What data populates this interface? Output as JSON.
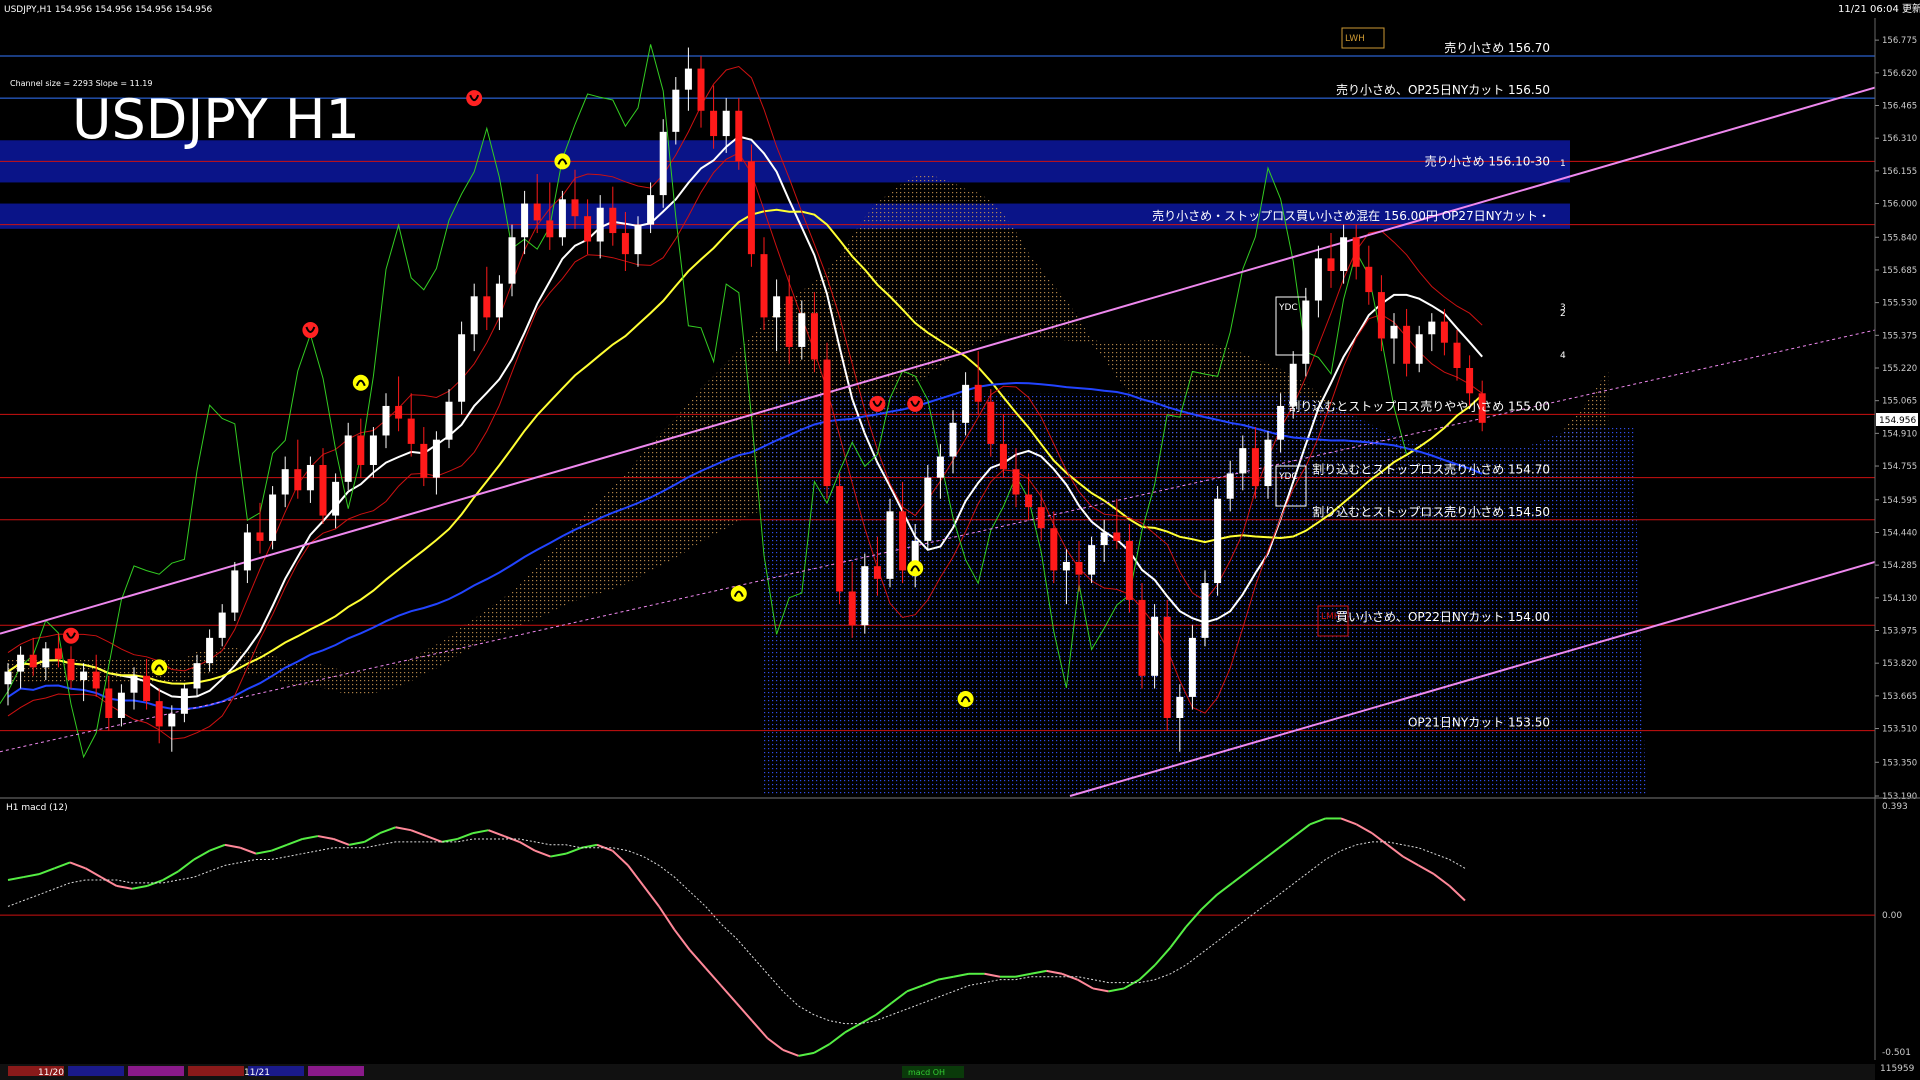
{
  "header": {
    "symbol_info": "USDJPY,H1  154.956 154.956 154.956 154.956",
    "timestamp": "11/21 06:04 更新",
    "channel_info": "Channel size = 2293 Slope = 11.19",
    "big_title": "USDJPY H1"
  },
  "macd_panel": {
    "title": "H1  macd (12)",
    "scale_top": "0.393",
    "scale_zero": "0.00",
    "scale_bottom": "-0.501"
  },
  "time_axis": {
    "labels": [
      "11/20",
      "11/21"
    ]
  },
  "current_price": "154.956",
  "volume_label": "115959",
  "bottom_tab": "macd OH",
  "colors": {
    "background": "#000000",
    "bull_candle": "#ffffff",
    "bear_candle": "#ff1a1a",
    "band": "#0a1488",
    "channel": "#ee88ee",
    "ma_white": "#ffffff",
    "ma_yellow": "#ffff33",
    "ma_blue": "#2244ff",
    "macd_up": "#55ee44",
    "macd_down": "#ff8899"
  },
  "chart_data": [
    {
      "type": "candlestick",
      "name": "USDJPY H1",
      "y_ticks": [
        "156.775",
        "156.620",
        "156.465",
        "156.310",
        "156.155",
        "156.000",
        "155.840",
        "155.685",
        "155.530",
        "155.375",
        "155.220",
        "155.065",
        "154.910",
        "154.755",
        "154.595",
        "154.440",
        "154.285",
        "154.130",
        "153.975",
        "153.820",
        "153.665",
        "153.510",
        "153.350",
        "153.190"
      ],
      "ylim": [
        153.19,
        156.88
      ],
      "price_levels": [
        {
          "price": 156.7,
          "label": "売り小さめ 156.70"
        },
        {
          "price": 156.5,
          "label": "売り小さめ、OP25日NYカット 156.50"
        },
        {
          "price": 156.2,
          "label": "売り小さめ 156.10-30"
        },
        {
          "price": 155.9,
          "label": "売り小さめ・ストップロス買い小さめ混在 156.00円 OP27日NYカット・"
        },
        {
          "price": 155.0,
          "label": "割り込むとストップロス売りやや小さめ 155.00"
        },
        {
          "price": 154.7,
          "label": "割り込むとストップロス売り小さめ 154.70"
        },
        {
          "price": 154.5,
          "label": "割り込むとストップロス売り小さめ 154.50"
        },
        {
          "price": 154.0,
          "label": "買い小さめ、OP22日NYカット 154.00"
        },
        {
          "price": 153.5,
          "label": "OP21日NYカット 153.50"
        }
      ],
      "box_labels": [
        "LWH",
        "YDC",
        "YDC",
        "LMH"
      ],
      "channel_labels": [
        "1",
        "2",
        "3",
        "4"
      ],
      "candles": [
        [
          153.72,
          153.82,
          153.62,
          153.78
        ],
        [
          153.78,
          153.9,
          153.7,
          153.86
        ],
        [
          153.86,
          153.94,
          153.76,
          153.8
        ],
        [
          153.8,
          153.92,
          153.74,
          153.89
        ],
        [
          153.89,
          153.96,
          153.8,
          153.84
        ],
        [
          153.84,
          153.9,
          153.7,
          153.74
        ],
        [
          153.74,
          153.82,
          153.64,
          153.78
        ],
        [
          153.78,
          153.86,
          153.66,
          153.7
        ],
        [
          153.7,
          153.76,
          153.5,
          153.56
        ],
        [
          153.56,
          153.72,
          153.52,
          153.68
        ],
        [
          153.68,
          153.8,
          153.6,
          153.76
        ],
        [
          153.76,
          153.84,
          153.6,
          153.64
        ],
        [
          153.64,
          153.7,
          153.44,
          153.52
        ],
        [
          153.52,
          153.62,
          153.4,
          153.58
        ],
        [
          153.58,
          153.72,
          153.54,
          153.7
        ],
        [
          153.7,
          153.86,
          153.66,
          153.82
        ],
        [
          153.82,
          153.98,
          153.78,
          153.94
        ],
        [
          153.94,
          154.1,
          153.9,
          154.06
        ],
        [
          154.06,
          154.3,
          154.02,
          154.26
        ],
        [
          154.26,
          154.48,
          154.2,
          154.44
        ],
        [
          154.44,
          154.58,
          154.34,
          154.4
        ],
        [
          154.4,
          154.66,
          154.36,
          154.62
        ],
        [
          154.62,
          154.8,
          154.56,
          154.74
        ],
        [
          154.74,
          154.88,
          154.6,
          154.64
        ],
        [
          154.64,
          154.8,
          154.58,
          154.76
        ],
        [
          154.76,
          154.84,
          154.48,
          154.52
        ],
        [
          154.52,
          154.72,
          154.46,
          154.68
        ],
        [
          154.68,
          154.96,
          154.64,
          154.9
        ],
        [
          154.9,
          154.98,
          154.7,
          154.76
        ],
        [
          154.76,
          154.94,
          154.7,
          154.9
        ],
        [
          154.9,
          155.1,
          154.84,
          155.04
        ],
        [
          155.04,
          155.18,
          154.92,
          154.98
        ],
        [
          154.98,
          155.1,
          154.8,
          154.86
        ],
        [
          154.86,
          154.94,
          154.66,
          154.7
        ],
        [
          154.7,
          154.92,
          154.62,
          154.88
        ],
        [
          154.88,
          155.12,
          154.84,
          155.06
        ],
        [
          155.06,
          155.44,
          155.0,
          155.38
        ],
        [
          155.38,
          155.62,
          155.3,
          155.56
        ],
        [
          155.56,
          155.7,
          155.4,
          155.46
        ],
        [
          155.46,
          155.66,
          155.4,
          155.62
        ],
        [
          155.62,
          155.9,
          155.56,
          155.84
        ],
        [
          155.84,
          156.06,
          155.76,
          156.0
        ],
        [
          156.0,
          156.14,
          155.86,
          155.92
        ],
        [
          155.92,
          156.1,
          155.78,
          155.84
        ],
        [
          155.84,
          156.06,
          155.8,
          156.02
        ],
        [
          156.02,
          156.16,
          155.88,
          155.94
        ],
        [
          155.94,
          156.02,
          155.76,
          155.82
        ],
        [
          155.82,
          156.04,
          155.74,
          155.98
        ],
        [
          155.98,
          156.08,
          155.8,
          155.86
        ],
        [
          155.86,
          155.96,
          155.68,
          155.76
        ],
        [
          155.76,
          155.94,
          155.7,
          155.9
        ],
        [
          155.9,
          156.1,
          155.86,
          156.04
        ],
        [
          156.04,
          156.4,
          155.98,
          156.34
        ],
        [
          156.34,
          156.6,
          156.28,
          156.54
        ],
        [
          156.54,
          156.74,
          156.44,
          156.64
        ],
        [
          156.64,
          156.7,
          156.36,
          156.44
        ],
        [
          156.44,
          156.56,
          156.26,
          156.32
        ],
        [
          156.32,
          156.5,
          156.24,
          156.44
        ],
        [
          156.44,
          156.5,
          156.16,
          156.2
        ],
        [
          156.2,
          156.28,
          155.7,
          155.76
        ],
        [
          155.76,
          155.84,
          155.4,
          155.46
        ],
        [
          155.46,
          155.64,
          155.3,
          155.56
        ],
        [
          155.56,
          155.66,
          155.24,
          155.32
        ],
        [
          155.32,
          155.54,
          155.26,
          155.48
        ],
        [
          155.48,
          155.58,
          155.2,
          155.26
        ],
        [
          155.26,
          155.34,
          154.6,
          154.66
        ],
        [
          154.66,
          154.72,
          154.1,
          154.16
        ],
        [
          154.16,
          154.3,
          153.94,
          154.0
        ],
        [
          154.0,
          154.34,
          153.96,
          154.28
        ],
        [
          154.28,
          154.42,
          154.14,
          154.22
        ],
        [
          154.22,
          154.6,
          154.18,
          154.54
        ],
        [
          154.54,
          154.68,
          154.2,
          154.26
        ],
        [
          154.26,
          154.48,
          154.18,
          154.4
        ],
        [
          154.4,
          154.76,
          154.36,
          154.7
        ],
        [
          154.7,
          154.86,
          154.6,
          154.8
        ],
        [
          154.8,
          155.02,
          154.72,
          154.96
        ],
        [
          154.96,
          155.2,
          154.9,
          155.14
        ],
        [
          155.14,
          155.3,
          155.0,
          155.06
        ],
        [
          155.06,
          155.12,
          154.8,
          154.86
        ],
        [
          154.86,
          155.0,
          154.7,
          154.74
        ],
        [
          154.74,
          154.84,
          154.56,
          154.62
        ],
        [
          154.62,
          154.72,
          154.5,
          154.56
        ],
        [
          154.56,
          154.64,
          154.4,
          154.46
        ],
        [
          154.46,
          154.54,
          154.2,
          154.26
        ],
        [
          154.26,
          154.36,
          154.1,
          154.3
        ],
        [
          154.3,
          154.4,
          154.16,
          154.24
        ],
        [
          154.24,
          154.42,
          154.2,
          154.38
        ],
        [
          154.38,
          154.5,
          154.3,
          154.44
        ],
        [
          154.44,
          154.6,
          154.36,
          154.4
        ],
        [
          154.4,
          154.48,
          154.06,
          154.12
        ],
        [
          154.12,
          154.2,
          153.7,
          153.76
        ],
        [
          153.76,
          154.1,
          153.7,
          154.04
        ],
        [
          154.04,
          154.12,
          153.5,
          153.56
        ],
        [
          153.56,
          153.72,
          153.4,
          153.66
        ],
        [
          153.66,
          154.0,
          153.6,
          153.94
        ],
        [
          153.94,
          154.26,
          153.9,
          154.2
        ],
        [
          154.2,
          154.66,
          154.14,
          154.6
        ],
        [
          154.6,
          154.78,
          154.54,
          154.72
        ],
        [
          154.72,
          154.9,
          154.64,
          154.84
        ],
        [
          154.84,
          154.94,
          154.6,
          154.66
        ],
        [
          154.66,
          154.92,
          154.6,
          154.88
        ],
        [
          154.88,
          155.1,
          154.82,
          155.04
        ],
        [
          155.04,
          155.3,
          154.98,
          155.24
        ],
        [
          155.24,
          155.6,
          155.18,
          155.54
        ],
        [
          155.54,
          155.8,
          155.46,
          155.74
        ],
        [
          155.74,
          155.86,
          155.6,
          155.68
        ],
        [
          155.68,
          155.9,
          155.62,
          155.84
        ],
        [
          155.84,
          155.9,
          155.64,
          155.7
        ],
        [
          155.7,
          155.8,
          155.52,
          155.58
        ],
        [
          155.58,
          155.66,
          155.3,
          155.36
        ],
        [
          155.36,
          155.48,
          155.24,
          155.42
        ],
        [
          155.42,
          155.5,
          155.18,
          155.24
        ],
        [
          155.24,
          155.42,
          155.2,
          155.38
        ],
        [
          155.38,
          155.48,
          155.3,
          155.44
        ],
        [
          155.44,
          155.5,
          155.28,
          155.34
        ],
        [
          155.34,
          155.4,
          155.16,
          155.22
        ],
        [
          155.22,
          155.28,
          155.04,
          155.1
        ],
        [
          155.1,
          155.16,
          154.92,
          154.96
        ]
      ]
    },
    {
      "type": "line",
      "name": "macd (12)",
      "ylim": [
        -0.501,
        0.393
      ],
      "series": [
        {
          "values": [
            0.12,
            0.13,
            0.14,
            0.16,
            0.18,
            0.16,
            0.13,
            0.1,
            0.09,
            0.1,
            0.12,
            0.15,
            0.19,
            0.22,
            0.24,
            0.23,
            0.21,
            0.22,
            0.24,
            0.26,
            0.27,
            0.26,
            0.24,
            0.25,
            0.28,
            0.3,
            0.29,
            0.27,
            0.25,
            0.26,
            0.28,
            0.29,
            0.27,
            0.25,
            0.22,
            0.2,
            0.21,
            0.23,
            0.24,
            0.22,
            0.17,
            0.1,
            0.03,
            -0.05,
            -0.12,
            -0.18,
            -0.24,
            -0.3,
            -0.36,
            -0.42,
            -0.46,
            -0.48,
            -0.47,
            -0.44,
            -0.4,
            -0.37,
            -0.34,
            -0.3,
            -0.26,
            -0.24,
            -0.22,
            -0.21,
            -0.2,
            -0.2,
            -0.21,
            -0.21,
            -0.2,
            -0.19,
            -0.2,
            -0.22,
            -0.25,
            -0.26,
            -0.25,
            -0.22,
            -0.17,
            -0.11,
            -0.04,
            0.02,
            0.07,
            0.11,
            0.15,
            0.19,
            0.23,
            0.27,
            0.31,
            0.33,
            0.33,
            0.31,
            0.28,
            0.24,
            0.2,
            0.17,
            0.14,
            0.1,
            0.05
          ]
        },
        {
          "values": [
            0.03,
            0.05,
            0.07,
            0.09,
            0.11,
            0.12,
            0.12,
            0.12,
            0.11,
            0.11,
            0.11,
            0.12,
            0.13,
            0.15,
            0.17,
            0.18,
            0.19,
            0.19,
            0.2,
            0.21,
            0.22,
            0.23,
            0.23,
            0.23,
            0.24,
            0.25,
            0.25,
            0.25,
            0.25,
            0.25,
            0.26,
            0.26,
            0.26,
            0.26,
            0.25,
            0.24,
            0.24,
            0.23,
            0.23,
            0.23,
            0.22,
            0.2,
            0.17,
            0.13,
            0.08,
            0.03,
            -0.03,
            -0.08,
            -0.14,
            -0.2,
            -0.26,
            -0.31,
            -0.34,
            -0.36,
            -0.37,
            -0.37,
            -0.36,
            -0.34,
            -0.32,
            -0.3,
            -0.28,
            -0.26,
            -0.24,
            -0.23,
            -0.22,
            -0.22,
            -0.21,
            -0.21,
            -0.21,
            -0.21,
            -0.22,
            -0.23,
            -0.23,
            -0.23,
            -0.22,
            -0.2,
            -0.17,
            -0.13,
            -0.09,
            -0.05,
            -0.01,
            0.03,
            0.07,
            0.11,
            0.15,
            0.19,
            0.22,
            0.24,
            0.25,
            0.25,
            0.24,
            0.23,
            0.21,
            0.19,
            0.16
          ]
        }
      ]
    }
  ]
}
